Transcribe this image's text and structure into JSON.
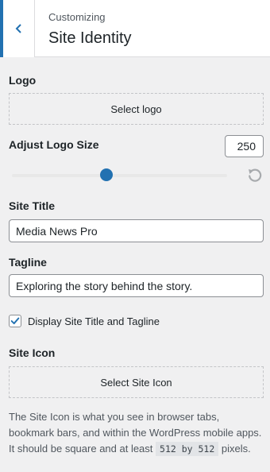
{
  "header": {
    "eyebrow": "Customizing",
    "title": "Site Identity"
  },
  "logo": {
    "label": "Logo",
    "button_label": "Select logo"
  },
  "logo_size": {
    "label": "Adjust Logo Size",
    "value": "250",
    "slider_fraction": 0.44
  },
  "site_title": {
    "label": "Site Title",
    "value": "Media News Pro"
  },
  "tagline": {
    "label": "Tagline",
    "value": "Exploring the story behind the story."
  },
  "display_title_tagline": {
    "label": "Display Site Title and Tagline",
    "checked": true
  },
  "site_icon": {
    "label": "Site Icon",
    "button_label": "Select Site Icon",
    "description_before": "The Site Icon is what you see in browser tabs, bookmark bars, and within the WordPress mobile apps. It should be square and at least ",
    "description_code": "512 by 512",
    "description_after": " pixels."
  },
  "colors": {
    "accent": "#2271b1",
    "background": "#f0f0f1"
  }
}
